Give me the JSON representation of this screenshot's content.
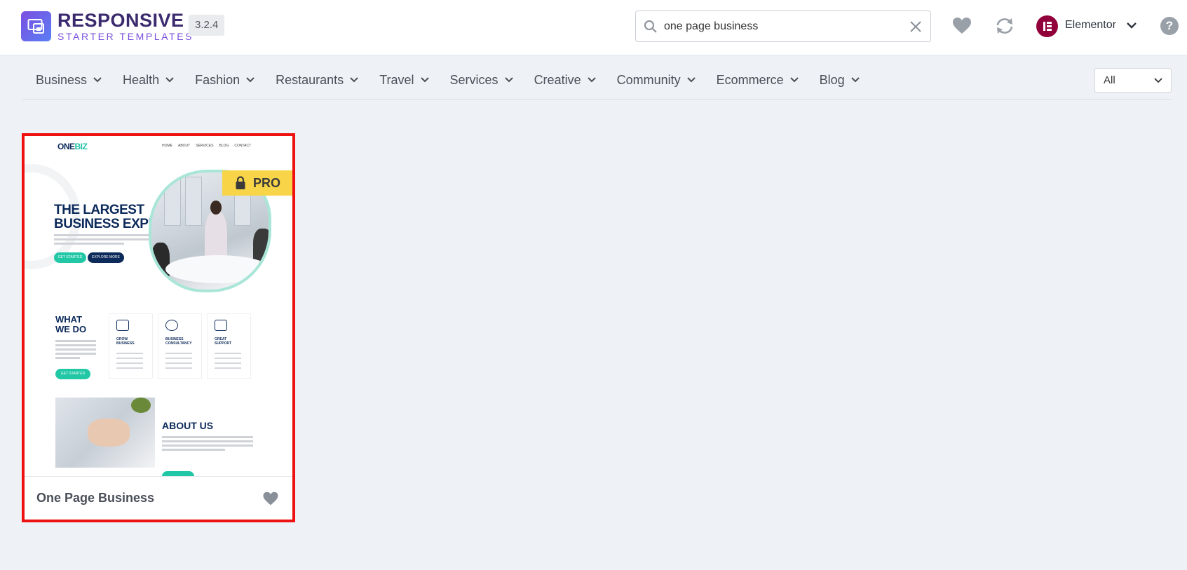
{
  "header": {
    "brand_title": "RESPONSIVE",
    "brand_subtitle": "STARTER TEMPLATES",
    "version": "3.2.4",
    "search": {
      "value": "one page business"
    },
    "builder_label": "Elementor",
    "help_label": "?"
  },
  "categories": [
    {
      "label": "Business"
    },
    {
      "label": "Health"
    },
    {
      "label": "Fashion"
    },
    {
      "label": "Restaurants"
    },
    {
      "label": "Travel"
    },
    {
      "label": "Services"
    },
    {
      "label": "Creative"
    },
    {
      "label": "Community"
    },
    {
      "label": "Ecommerce"
    },
    {
      "label": "Blog"
    }
  ],
  "filter": {
    "selected": "All"
  },
  "card": {
    "title": "One Page Business",
    "badge": "PRO",
    "preview": {
      "logo_a": "ONE",
      "logo_b": "BIZ",
      "nav": [
        "HOME",
        "ABOUT",
        "SERVICES",
        "BLOG",
        "CONTACT"
      ],
      "hero_line1": "THE LARGEST",
      "hero_line2": "BUSINESS EXPERT",
      "btn_primary": "GET STARTED",
      "btn_secondary": "EXPLORE MORE",
      "what_line1": "WHAT",
      "what_line2": "WE DO",
      "what_btn": "GET STARTED",
      "services": [
        {
          "line1": "GROW",
          "line2": "BUSINESS"
        },
        {
          "line1": "BUSINESS",
          "line2": "CONSULTANCY"
        },
        {
          "line1": "GREAT",
          "line2": "SUPPORT"
        }
      ],
      "about_title": "ABOUT US"
    }
  },
  "colors": {
    "accent_red": "#ee1111",
    "brand_purple": "#3b2a6e",
    "pro_yellow": "#f8d548",
    "elementor": "#92003b"
  }
}
